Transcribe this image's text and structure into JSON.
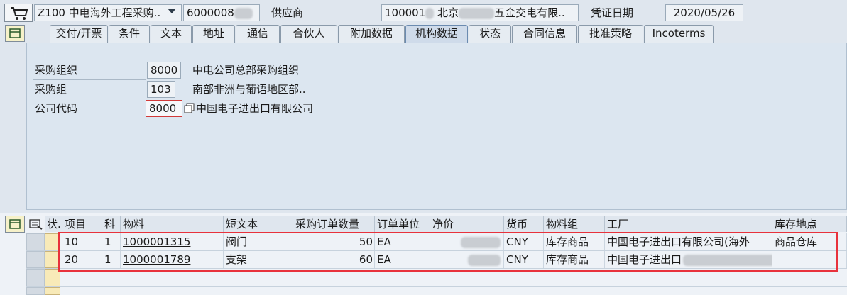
{
  "header": {
    "doc_type": "Z100 中电海外工程采购..",
    "vendor_number": "6000008",
    "vendor_label": "供应商",
    "vendor_prefix": "100001",
    "vendor_city": "北京",
    "vendor_suffix": "五金交电有限..",
    "doc_date_label": "凭证日期",
    "doc_date": "2020/05/26"
  },
  "tabs": [
    "交付/开票",
    "条件",
    "文本",
    "地址",
    "通信",
    "合伙人",
    "附加数据",
    "机构数据",
    "状态",
    "合同信息",
    "批准策略",
    "Incoterms"
  ],
  "active_tab": "机构数据",
  "org_data": {
    "purch_org_label": "采购组织",
    "purch_org_code": "8000",
    "purch_org_name": "中电公司总部采购组织",
    "purch_group_label": "采购组",
    "purch_group_code": "103",
    "purch_group_name": "南部非洲与葡语地区部..",
    "company_code_label": "公司代码",
    "company_code": "8000",
    "company_name": "中国电子进出口有限公司"
  },
  "table": {
    "columns": [
      "状.",
      "项目",
      "科",
      "物料",
      "短文本",
      "采购订单数量",
      "订单单位",
      "净价",
      "货币",
      "物料组",
      "工厂",
      "库存地点"
    ],
    "rows": [
      {
        "item": "10",
        "acct": "1",
        "material": "1000001315",
        "short_text": "阀门",
        "qty": "50",
        "unit": "EA",
        "currency": "CNY",
        "mat_group": "库存商品",
        "plant": "中国电子进出口有限公司(海外",
        "storage": "商品仓库"
      },
      {
        "item": "20",
        "acct": "1",
        "material": "1000001789",
        "short_text": "支架",
        "qty": "60",
        "unit": "EA",
        "currency": "CNY",
        "mat_group": "库存商品",
        "plant": "中国电子进出口",
        "storage": ""
      }
    ]
  },
  "colors": {
    "highlight": "#e8323c",
    "active_tab": "#cfdbea"
  }
}
